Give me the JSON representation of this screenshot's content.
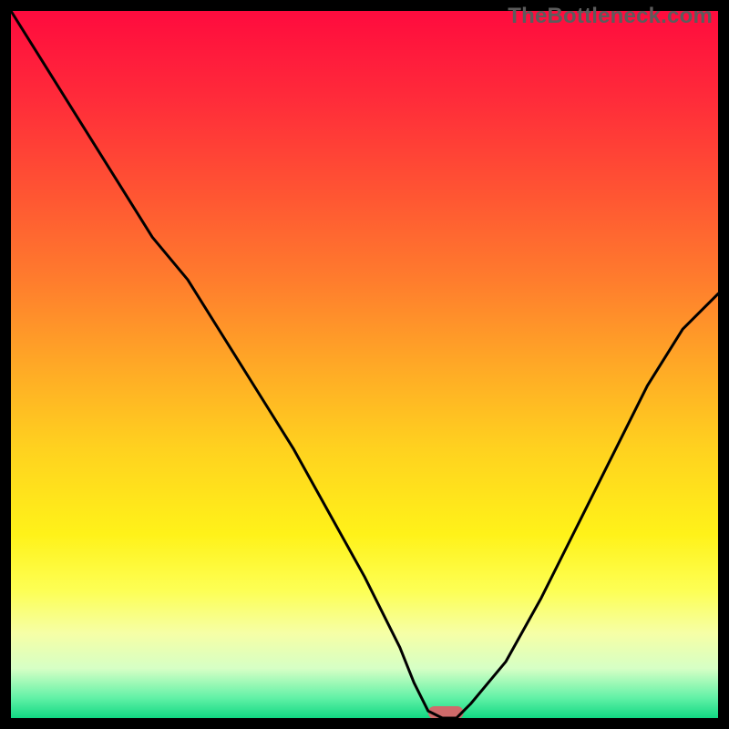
{
  "watermark": "TheBottleneck.com",
  "colors": {
    "gradient_stops": [
      {
        "offset": 0.0,
        "color": "#ff0b3e"
      },
      {
        "offset": 0.12,
        "color": "#ff2a3a"
      },
      {
        "offset": 0.25,
        "color": "#ff5233"
      },
      {
        "offset": 0.38,
        "color": "#ff7c2d"
      },
      {
        "offset": 0.5,
        "color": "#ffa826"
      },
      {
        "offset": 0.62,
        "color": "#ffd21f"
      },
      {
        "offset": 0.74,
        "color": "#fff219"
      },
      {
        "offset": 0.82,
        "color": "#fdff55"
      },
      {
        "offset": 0.88,
        "color": "#f6ffa6"
      },
      {
        "offset": 0.93,
        "color": "#d6ffc5"
      },
      {
        "offset": 0.97,
        "color": "#66f2a8"
      },
      {
        "offset": 1.0,
        "color": "#11d983"
      }
    ],
    "curve": "#000000",
    "frame": "#000000",
    "marker": "#cf6b6b"
  },
  "chart_data": {
    "type": "line",
    "title": "",
    "xlabel": "",
    "ylabel": "",
    "xlim": [
      0,
      100
    ],
    "ylim": [
      0,
      100
    ],
    "grid": false,
    "legend": false,
    "x": [
      0,
      5,
      10,
      15,
      20,
      25,
      30,
      35,
      40,
      45,
      50,
      55,
      57,
      59,
      61,
      63,
      65,
      70,
      75,
      80,
      85,
      90,
      95,
      100
    ],
    "values": [
      100,
      92,
      84,
      76,
      68,
      62,
      54,
      46,
      38,
      29,
      20,
      10,
      5,
      1,
      0,
      0,
      2,
      8,
      17,
      27,
      37,
      47,
      55,
      60
    ],
    "marker": {
      "x0": 59,
      "x1": 64,
      "y": 0
    }
  }
}
